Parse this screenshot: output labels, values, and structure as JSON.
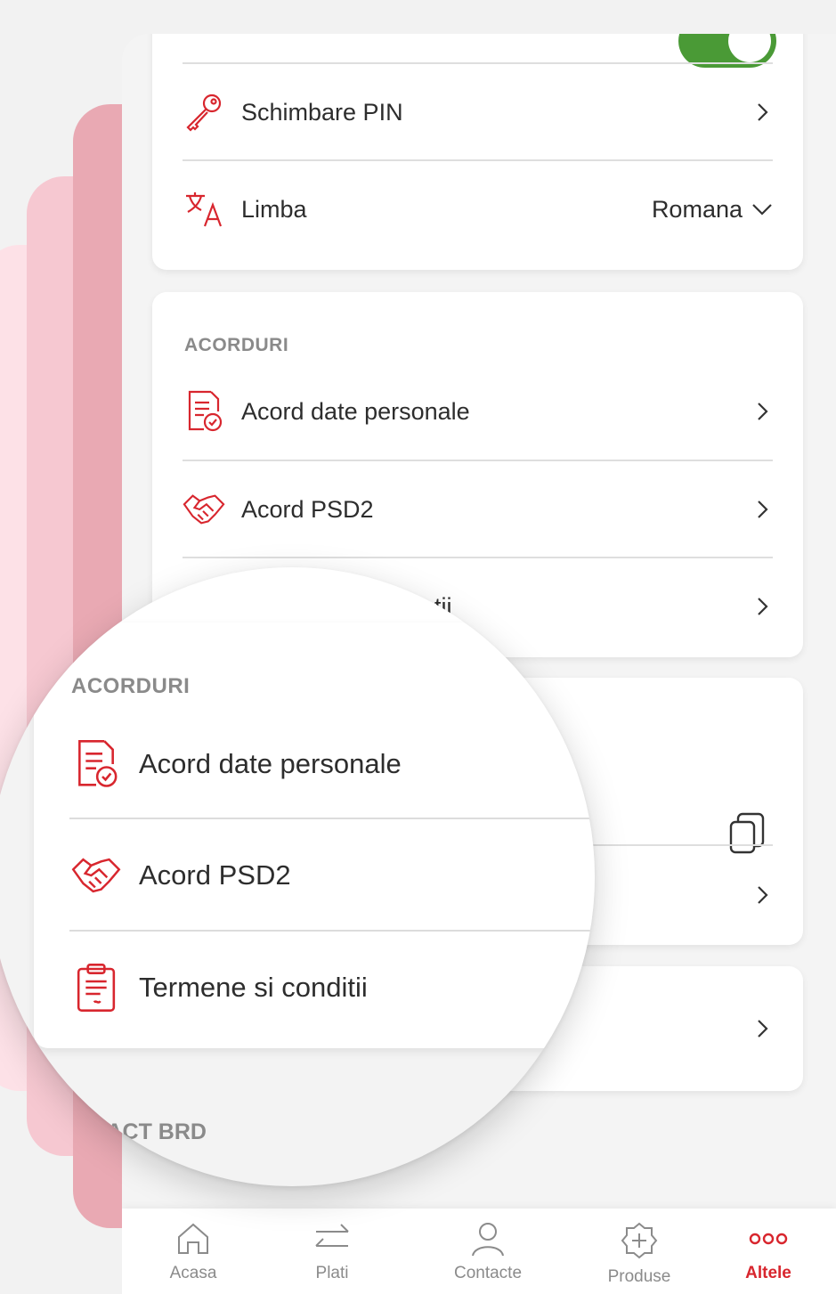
{
  "settings": {
    "change_pin": "Schimbare PIN",
    "language_label": "Limba",
    "language_value": "Romana"
  },
  "agreements": {
    "title": "ACORDURI",
    "items": [
      {
        "label": "Acord date personale",
        "icon": "document-check-icon"
      },
      {
        "label": "Acord PSD2",
        "icon": "handshake-icon"
      },
      {
        "label": "Termene si conditii",
        "icon": "clipboard-icon"
      }
    ],
    "partial_label": "…tii"
  },
  "contact": {
    "title": "NTACT BRD"
  },
  "nav": {
    "tabs": [
      {
        "label": "Acasa",
        "icon": "home-icon"
      },
      {
        "label": "Plati",
        "icon": "transfer-icon"
      },
      {
        "label": "Contacte",
        "icon": "person-icon"
      },
      {
        "label": "Produse",
        "icon": "products-icon"
      },
      {
        "label": "Altele",
        "icon": "more-icon",
        "active": true
      }
    ]
  },
  "colors": {
    "accent": "#d8262e",
    "toggle": "#4a9a36",
    "pink_light": "#fde1e7",
    "pink_mid": "#f6c8d1",
    "pink_dark": "#e9a9b3"
  }
}
